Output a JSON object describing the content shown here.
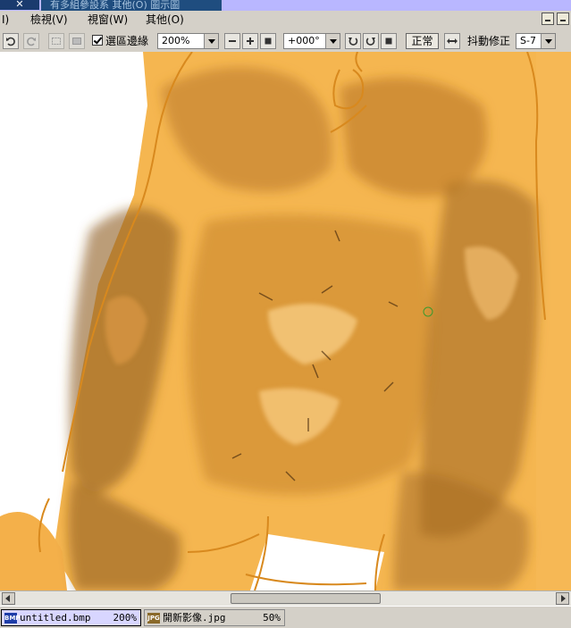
{
  "titlebar": {
    "close_glyph": "✕",
    "title_fragment": "有多組參設系  其他(O)  圖示圖"
  },
  "menu": {
    "items": [
      "I)",
      "檢視(V)",
      "視窗(W)",
      "其他(O)"
    ]
  },
  "toolbar": {
    "show_selection_label": "選區邊緣",
    "show_selection_checked": true,
    "zoom_value": "200%",
    "rotation_value": "+000°",
    "normal_button": "正常",
    "stabilizer_label": "抖動修正",
    "stabilizer_value": "S-7"
  },
  "canvas": {
    "skin_color": "#f2b04a",
    "shadow_color": "#8a5a1e"
  },
  "document_tabs": [
    {
      "icon": "BMP",
      "filename": "untitled.bmp",
      "zoom": "200%",
      "active": true
    },
    {
      "icon": "JPG",
      "filename": "開新影像.jpg",
      "zoom": "50%",
      "active": false
    }
  ]
}
